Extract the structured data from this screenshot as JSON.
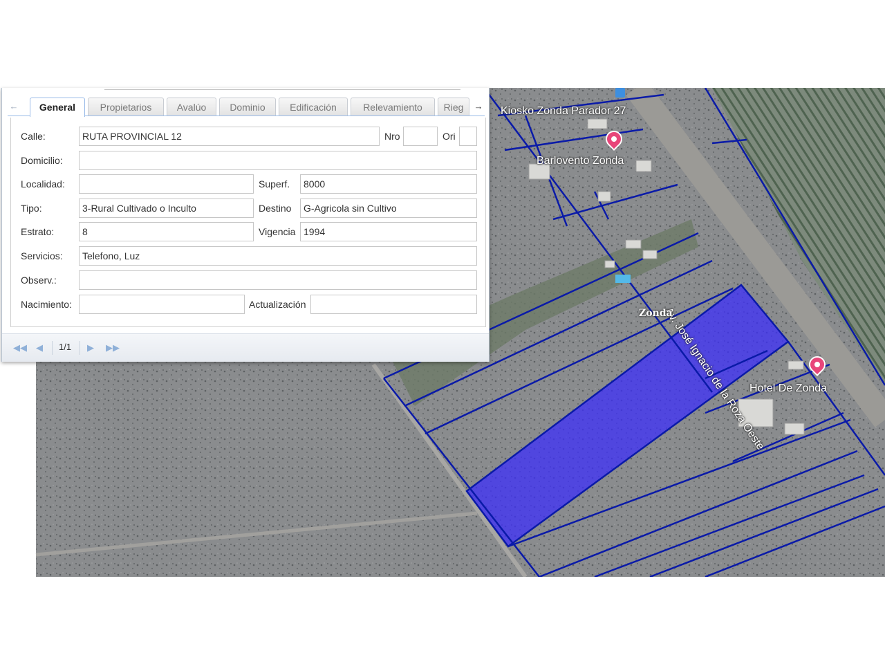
{
  "tabs": [
    {
      "label": "General",
      "active": true
    },
    {
      "label": "Propietarios",
      "active": false
    },
    {
      "label": "Avalúo",
      "active": false
    },
    {
      "label": "Dominio",
      "active": false
    },
    {
      "label": "Edificación",
      "active": false
    },
    {
      "label": "Relevamiento",
      "active": false
    },
    {
      "label": "Rieg",
      "active": false
    }
  ],
  "form": {
    "calle": {
      "label": "Calle:",
      "value": "RUTA PROVINCIAL 12"
    },
    "nro": {
      "label": "Nro",
      "value": ""
    },
    "ori": {
      "label": "Ori",
      "value": ""
    },
    "domicilio": {
      "label": "Domicilio:",
      "value": ""
    },
    "localidad": {
      "label": "Localidad:",
      "value": ""
    },
    "superf": {
      "label": "Superf.",
      "value": "8000"
    },
    "tipo": {
      "label": "Tipo:",
      "value": "3-Rural Cultivado o Inculto"
    },
    "destino": {
      "label": "Destino",
      "value": "G-Agricola sin Cultivo"
    },
    "estrato": {
      "label": "Estrato:",
      "value": "8"
    },
    "vigencia": {
      "label": "Vigencia",
      "value": "1994"
    },
    "servicios": {
      "label": "Servicios:",
      "value": "Telefono, Luz"
    },
    "observ": {
      "label": "Observ.:",
      "value": ""
    },
    "nacimiento": {
      "label": "Nacimiento:",
      "value": ""
    },
    "actualizacion": {
      "label": "Actualización",
      "value": ""
    }
  },
  "pager": {
    "page_display": "1/1"
  },
  "map": {
    "labels": {
      "kiosko": "Kiosko Zonda Parador 27",
      "barlovento": "Barlovento Zonda",
      "street": "Av. José Ignacio de la Roza Oeste",
      "zonda": "Zonda",
      "hotel": "Hotel De Zonda"
    },
    "colors": {
      "parcel_line": "#0a1aa8",
      "highlight_fill": "#3a2bff",
      "pin": "#e8457a"
    }
  }
}
